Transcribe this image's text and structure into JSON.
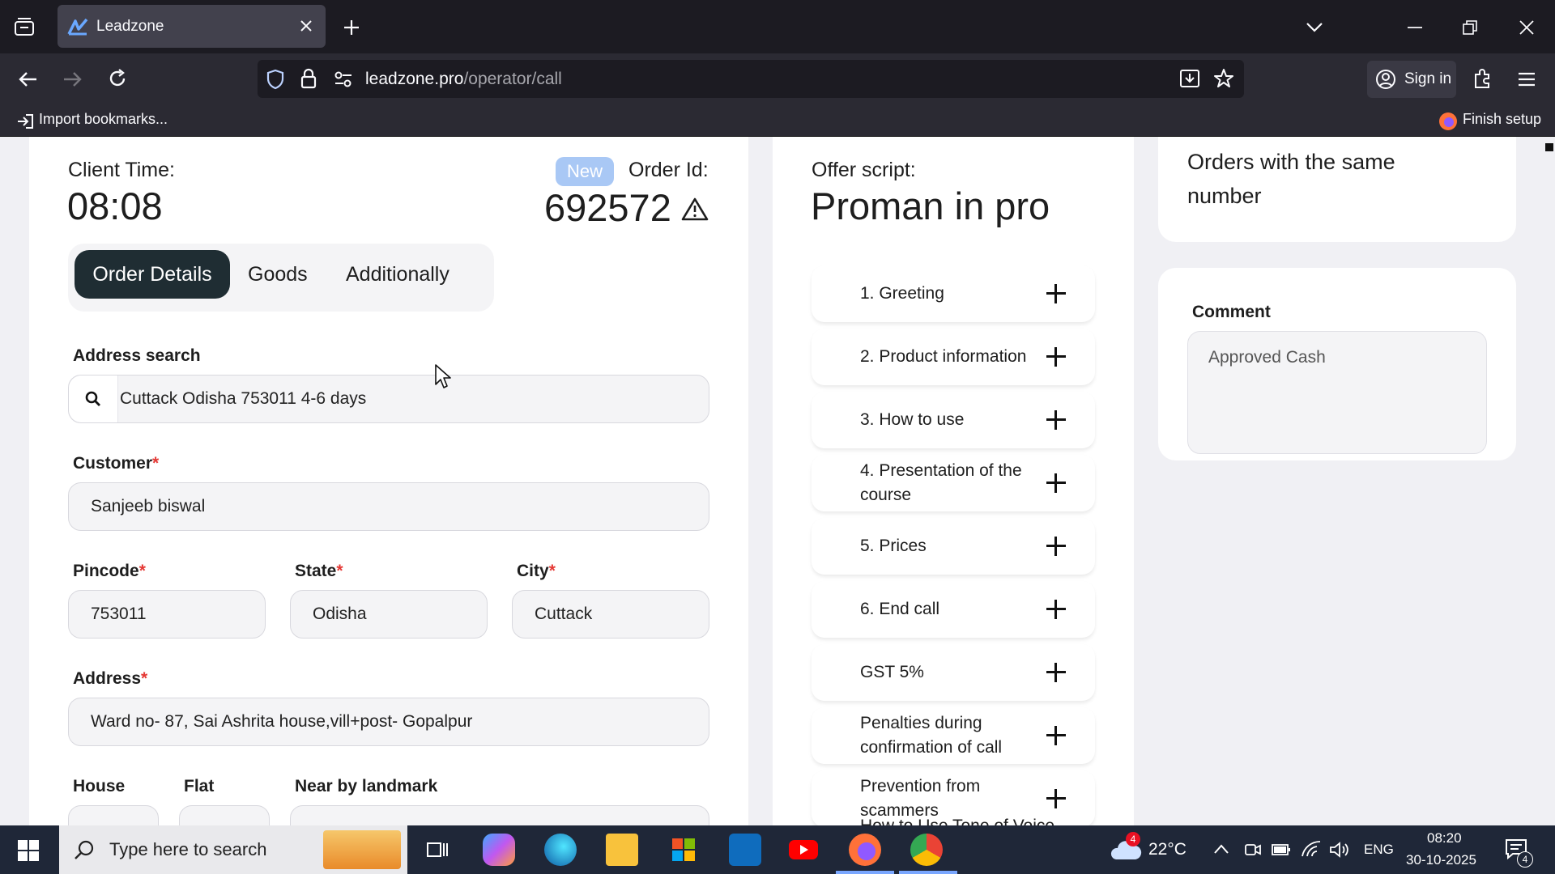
{
  "browser": {
    "tab_title": "Leadzone",
    "url_domain": "leadzone.pro",
    "url_path": "/operator/call",
    "sign_in": "Sign in",
    "import_bookmarks": "Import bookmarks...",
    "finish_setup": "Finish setup"
  },
  "order_panel": {
    "client_time_label": "Client Time:",
    "client_time": "08:08",
    "status_badge": "New",
    "order_id_label": "Order Id:",
    "order_id": "692572",
    "tabs": [
      {
        "label": "Order Details",
        "active": true
      },
      {
        "label": "Goods",
        "active": false
      },
      {
        "label": "Additionally",
        "active": false
      }
    ],
    "address_search_label": "Address search",
    "address_search_value": "Cuttack Odisha 753011 4-6 days",
    "customer_label": "Customer",
    "customer_value": "Sanjeeb biswal",
    "pincode_label": "Pincode",
    "pincode_value": "753011",
    "state_label": "State",
    "state_value": "Odisha",
    "city_label": "City",
    "city_value": "Cuttack",
    "address_label": "Address",
    "address_value": "Ward no- 87, Sai Ashrita house,vill+post- Gopalpur",
    "house_label": "House",
    "flat_label": "Flat",
    "landmark_label": "Near by landmark",
    "required_mark": "*"
  },
  "script_panel": {
    "offer_label": "Offer script:",
    "offer_title": "Proman in pro",
    "items": [
      "1. Greeting",
      "2. Product information",
      "3. How to use",
      "4. Presentation of the course",
      "5. Prices",
      "6. End call",
      "GST 5%",
      "Penalties during confirmation of call",
      "Prevention from scammers",
      "How to Use Tone of Voice"
    ]
  },
  "side_panel": {
    "same_number_title": "Orders with the same number",
    "comment_label": "Comment",
    "comment_value": "Approved Cash"
  },
  "taskbar": {
    "search_placeholder": "Type here to search",
    "weather_temp": "22°C",
    "weather_badge": "4",
    "language": "ENG",
    "time": "08:20",
    "date": "30-10-2025",
    "notification_count": "4"
  },
  "colors": {
    "accent_dark": "#1f2d33",
    "badge_blue": "#a9c8f5",
    "required_red": "#e53935"
  }
}
